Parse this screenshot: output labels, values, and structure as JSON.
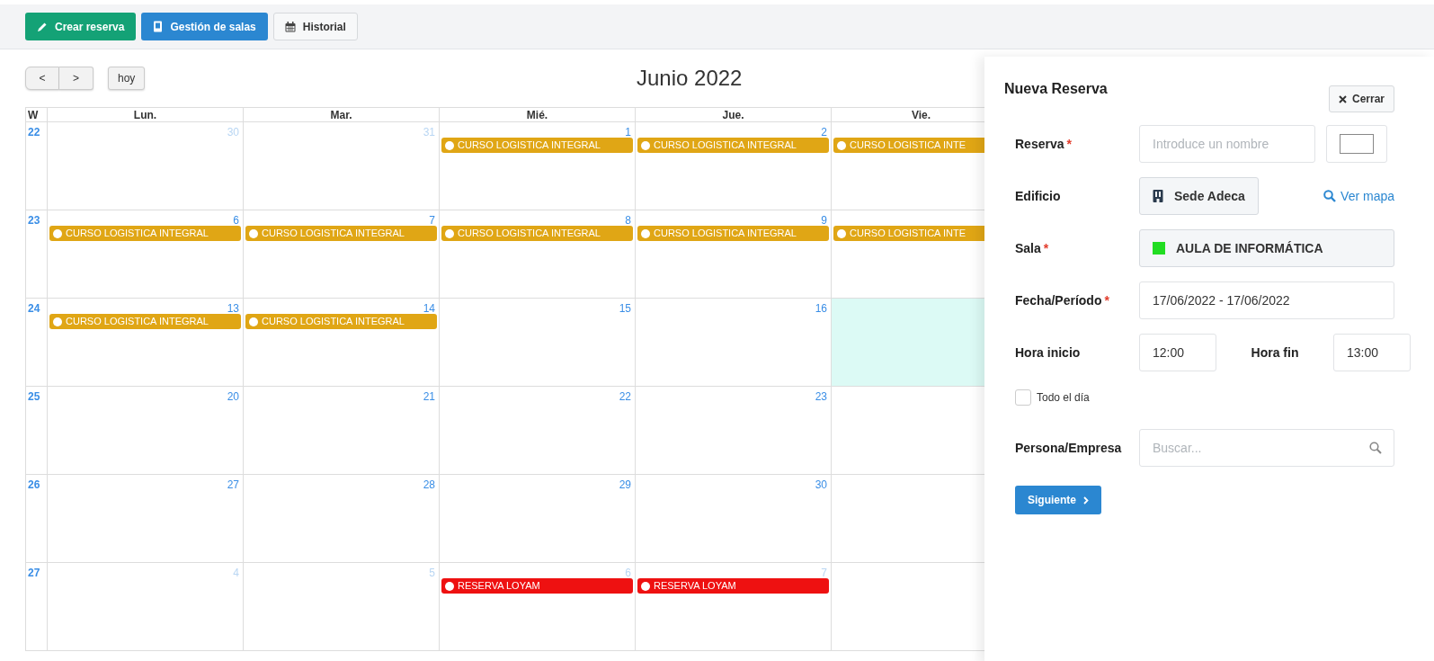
{
  "toolbar": {
    "buttons": [
      {
        "kind": "create",
        "label": "Crear reserva"
      },
      {
        "kind": "rooms",
        "label": "Gestión de salas"
      },
      {
        "kind": "history",
        "label": "Historial"
      }
    ]
  },
  "calendar": {
    "prev": "<",
    "next": ">",
    "today_button": "hoy",
    "title": "Junio 2022",
    "week_header": "W",
    "day_headers": [
      "Lun.",
      "Mar.",
      "Mié.",
      "Jue.",
      "Vie."
    ],
    "weeks": [
      {
        "week": "22",
        "days": [
          {
            "day": "30",
            "other_month": true,
            "today": false
          },
          {
            "day": "31",
            "other_month": true,
            "today": false
          },
          {
            "day": "1",
            "other_month": false,
            "today": false,
            "events": [
              {
                "title": "CURSO LOGISTICA INTEGRAL",
                "color": "#e0a615"
              }
            ]
          },
          {
            "day": "2",
            "other_month": false,
            "today": false,
            "events": [
              {
                "title": "CURSO LOGISTICA INTEGRAL",
                "color": "#e0a615"
              }
            ]
          },
          {
            "today": false,
            "events": [
              {
                "title": "CURSO LOGISTICA INTE",
                "color": "#e0a615"
              }
            ]
          }
        ]
      },
      {
        "week": "23",
        "days": [
          {
            "day": "6",
            "other_month": false,
            "today": false,
            "events": [
              {
                "title": "CURSO LOGISTICA INTEGRAL",
                "color": "#e0a615"
              }
            ]
          },
          {
            "day": "7",
            "other_month": false,
            "today": false,
            "events": [
              {
                "title": "CURSO LOGISTICA INTEGRAL",
                "color": "#e0a615"
              }
            ]
          },
          {
            "day": "8",
            "other_month": false,
            "today": false,
            "events": [
              {
                "title": "CURSO LOGISTICA INTEGRAL",
                "color": "#e0a615"
              }
            ]
          },
          {
            "day": "9",
            "other_month": false,
            "today": false,
            "events": [
              {
                "title": "CURSO LOGISTICA INTEGRAL",
                "color": "#e0a615"
              }
            ]
          },
          {
            "today": false,
            "events": [
              {
                "title": "CURSO LOGISTICA INTE",
                "color": "#e0a615"
              }
            ]
          }
        ]
      },
      {
        "week": "24",
        "days": [
          {
            "day": "13",
            "other_month": false,
            "today": false,
            "events": [
              {
                "title": "CURSO LOGISTICA INTEGRAL",
                "color": "#e0a615"
              }
            ]
          },
          {
            "day": "14",
            "other_month": false,
            "today": false,
            "events": [
              {
                "title": "CURSO LOGISTICA INTEGRAL",
                "color": "#e0a615"
              }
            ]
          },
          {
            "day": "15",
            "other_month": false,
            "today": false
          },
          {
            "day": "16",
            "other_month": false,
            "today": false
          },
          {
            "today": true
          }
        ]
      },
      {
        "week": "25",
        "days": [
          {
            "day": "20",
            "other_month": false,
            "today": false
          },
          {
            "day": "21",
            "other_month": false,
            "today": false
          },
          {
            "day": "22",
            "other_month": false,
            "today": false
          },
          {
            "day": "23",
            "other_month": false,
            "today": false
          },
          {
            "today": false
          }
        ]
      },
      {
        "week": "26",
        "days": [
          {
            "day": "27",
            "other_month": false,
            "today": false
          },
          {
            "day": "28",
            "other_month": false,
            "today": false
          },
          {
            "day": "29",
            "other_month": false,
            "today": false
          },
          {
            "day": "30",
            "other_month": false,
            "today": false
          },
          {
            "today": false
          }
        ]
      },
      {
        "week": "27",
        "days": [
          {
            "day": "4",
            "other_month": true,
            "today": false
          },
          {
            "day": "5",
            "other_month": true,
            "today": false
          },
          {
            "day": "6",
            "other_month": true,
            "today": false,
            "events": [
              {
                "title": "RESERVA LOYAM",
                "color": "#ee1111"
              }
            ]
          },
          {
            "day": "7",
            "other_month": true,
            "today": false,
            "events": [
              {
                "title": "RESERVA LOYAM",
                "color": "#ee1111"
              }
            ]
          },
          {
            "today": false
          }
        ]
      }
    ]
  },
  "panel": {
    "title": "Nueva Reserva",
    "close_button": "Cerrar",
    "reserva": {
      "label": "Reserva",
      "required_mark": "*",
      "placeholder": "Introduce un nombre"
    },
    "edificio": {
      "label": "Edificio",
      "value": "Sede Adeca",
      "map_link": "Ver mapa"
    },
    "sala": {
      "label": "Sala",
      "required_mark": "*",
      "value": "AULA DE INFORMÁTICA",
      "color": "#22dd22"
    },
    "fecha": {
      "label": "Fecha/Período",
      "required_mark": "*",
      "value": "17/06/2022 - 17/06/2022"
    },
    "hora_inicio": {
      "label": "Hora inicio",
      "value": "12:00"
    },
    "hora_fin": {
      "label": "Hora fin",
      "value": "13:00"
    },
    "todo_el_dia": {
      "label": "Todo el día",
      "checked": false
    },
    "persona": {
      "label": "Persona/Empresa",
      "placeholder": "Buscar..."
    },
    "next_button": "Siguiente"
  }
}
